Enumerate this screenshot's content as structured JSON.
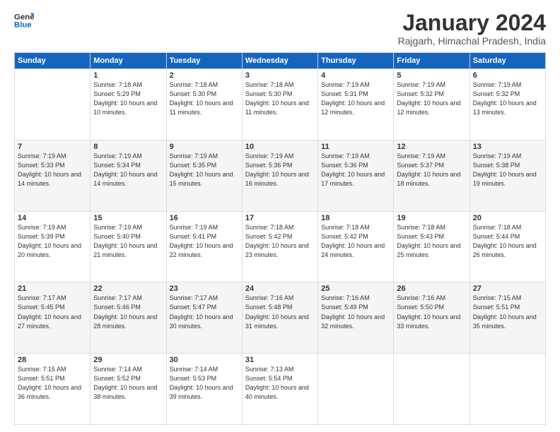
{
  "logo": {
    "line1": "General",
    "line2": "Blue"
  },
  "title": "January 2024",
  "location": "Rajgarh, Himachal Pradesh, India",
  "weekdays": [
    "Sunday",
    "Monday",
    "Tuesday",
    "Wednesday",
    "Thursday",
    "Friday",
    "Saturday"
  ],
  "weeks": [
    [
      {
        "day": "",
        "sunrise": "",
        "sunset": "",
        "daylight": ""
      },
      {
        "day": "1",
        "sunrise": "Sunrise: 7:18 AM",
        "sunset": "Sunset: 5:29 PM",
        "daylight": "Daylight: 10 hours and 10 minutes."
      },
      {
        "day": "2",
        "sunrise": "Sunrise: 7:18 AM",
        "sunset": "Sunset: 5:30 PM",
        "daylight": "Daylight: 10 hours and 11 minutes."
      },
      {
        "day": "3",
        "sunrise": "Sunrise: 7:18 AM",
        "sunset": "Sunset: 5:30 PM",
        "daylight": "Daylight: 10 hours and 11 minutes."
      },
      {
        "day": "4",
        "sunrise": "Sunrise: 7:19 AM",
        "sunset": "Sunset: 5:31 PM",
        "daylight": "Daylight: 10 hours and 12 minutes."
      },
      {
        "day": "5",
        "sunrise": "Sunrise: 7:19 AM",
        "sunset": "Sunset: 5:32 PM",
        "daylight": "Daylight: 10 hours and 12 minutes."
      },
      {
        "day": "6",
        "sunrise": "Sunrise: 7:19 AM",
        "sunset": "Sunset: 5:32 PM",
        "daylight": "Daylight: 10 hours and 13 minutes."
      }
    ],
    [
      {
        "day": "7",
        "sunrise": "Sunrise: 7:19 AM",
        "sunset": "Sunset: 5:33 PM",
        "daylight": "Daylight: 10 hours and 14 minutes."
      },
      {
        "day": "8",
        "sunrise": "Sunrise: 7:19 AM",
        "sunset": "Sunset: 5:34 PM",
        "daylight": "Daylight: 10 hours and 14 minutes."
      },
      {
        "day": "9",
        "sunrise": "Sunrise: 7:19 AM",
        "sunset": "Sunset: 5:35 PM",
        "daylight": "Daylight: 10 hours and 15 minutes."
      },
      {
        "day": "10",
        "sunrise": "Sunrise: 7:19 AM",
        "sunset": "Sunset: 5:36 PM",
        "daylight": "Daylight: 10 hours and 16 minutes."
      },
      {
        "day": "11",
        "sunrise": "Sunrise: 7:19 AM",
        "sunset": "Sunset: 5:36 PM",
        "daylight": "Daylight: 10 hours and 17 minutes."
      },
      {
        "day": "12",
        "sunrise": "Sunrise: 7:19 AM",
        "sunset": "Sunset: 5:37 PM",
        "daylight": "Daylight: 10 hours and 18 minutes."
      },
      {
        "day": "13",
        "sunrise": "Sunrise: 7:19 AM",
        "sunset": "Sunset: 5:38 PM",
        "daylight": "Daylight: 10 hours and 19 minutes."
      }
    ],
    [
      {
        "day": "14",
        "sunrise": "Sunrise: 7:19 AM",
        "sunset": "Sunset: 5:39 PM",
        "daylight": "Daylight: 10 hours and 20 minutes."
      },
      {
        "day": "15",
        "sunrise": "Sunrise: 7:19 AM",
        "sunset": "Sunset: 5:40 PM",
        "daylight": "Daylight: 10 hours and 21 minutes."
      },
      {
        "day": "16",
        "sunrise": "Sunrise: 7:19 AM",
        "sunset": "Sunset: 5:41 PM",
        "daylight": "Daylight: 10 hours and 22 minutes."
      },
      {
        "day": "17",
        "sunrise": "Sunrise: 7:18 AM",
        "sunset": "Sunset: 5:42 PM",
        "daylight": "Daylight: 10 hours and 23 minutes."
      },
      {
        "day": "18",
        "sunrise": "Sunrise: 7:18 AM",
        "sunset": "Sunset: 5:42 PM",
        "daylight": "Daylight: 10 hours and 24 minutes."
      },
      {
        "day": "19",
        "sunrise": "Sunrise: 7:18 AM",
        "sunset": "Sunset: 5:43 PM",
        "daylight": "Daylight: 10 hours and 25 minutes."
      },
      {
        "day": "20",
        "sunrise": "Sunrise: 7:18 AM",
        "sunset": "Sunset: 5:44 PM",
        "daylight": "Daylight: 10 hours and 26 minutes."
      }
    ],
    [
      {
        "day": "21",
        "sunrise": "Sunrise: 7:17 AM",
        "sunset": "Sunset: 5:45 PM",
        "daylight": "Daylight: 10 hours and 27 minutes."
      },
      {
        "day": "22",
        "sunrise": "Sunrise: 7:17 AM",
        "sunset": "Sunset: 5:46 PM",
        "daylight": "Daylight: 10 hours and 28 minutes."
      },
      {
        "day": "23",
        "sunrise": "Sunrise: 7:17 AM",
        "sunset": "Sunset: 5:47 PM",
        "daylight": "Daylight: 10 hours and 30 minutes."
      },
      {
        "day": "24",
        "sunrise": "Sunrise: 7:16 AM",
        "sunset": "Sunset: 5:48 PM",
        "daylight": "Daylight: 10 hours and 31 minutes."
      },
      {
        "day": "25",
        "sunrise": "Sunrise: 7:16 AM",
        "sunset": "Sunset: 5:49 PM",
        "daylight": "Daylight: 10 hours and 32 minutes."
      },
      {
        "day": "26",
        "sunrise": "Sunrise: 7:16 AM",
        "sunset": "Sunset: 5:50 PM",
        "daylight": "Daylight: 10 hours and 33 minutes."
      },
      {
        "day": "27",
        "sunrise": "Sunrise: 7:15 AM",
        "sunset": "Sunset: 5:51 PM",
        "daylight": "Daylight: 10 hours and 35 minutes."
      }
    ],
    [
      {
        "day": "28",
        "sunrise": "Sunrise: 7:15 AM",
        "sunset": "Sunset: 5:51 PM",
        "daylight": "Daylight: 10 hours and 36 minutes."
      },
      {
        "day": "29",
        "sunrise": "Sunrise: 7:14 AM",
        "sunset": "Sunset: 5:52 PM",
        "daylight": "Daylight: 10 hours and 38 minutes."
      },
      {
        "day": "30",
        "sunrise": "Sunrise: 7:14 AM",
        "sunset": "Sunset: 5:53 PM",
        "daylight": "Daylight: 10 hours and 39 minutes."
      },
      {
        "day": "31",
        "sunrise": "Sunrise: 7:13 AM",
        "sunset": "Sunset: 5:54 PM",
        "daylight": "Daylight: 10 hours and 40 minutes."
      },
      {
        "day": "",
        "sunrise": "",
        "sunset": "",
        "daylight": ""
      },
      {
        "day": "",
        "sunrise": "",
        "sunset": "",
        "daylight": ""
      },
      {
        "day": "",
        "sunrise": "",
        "sunset": "",
        "daylight": ""
      }
    ]
  ]
}
